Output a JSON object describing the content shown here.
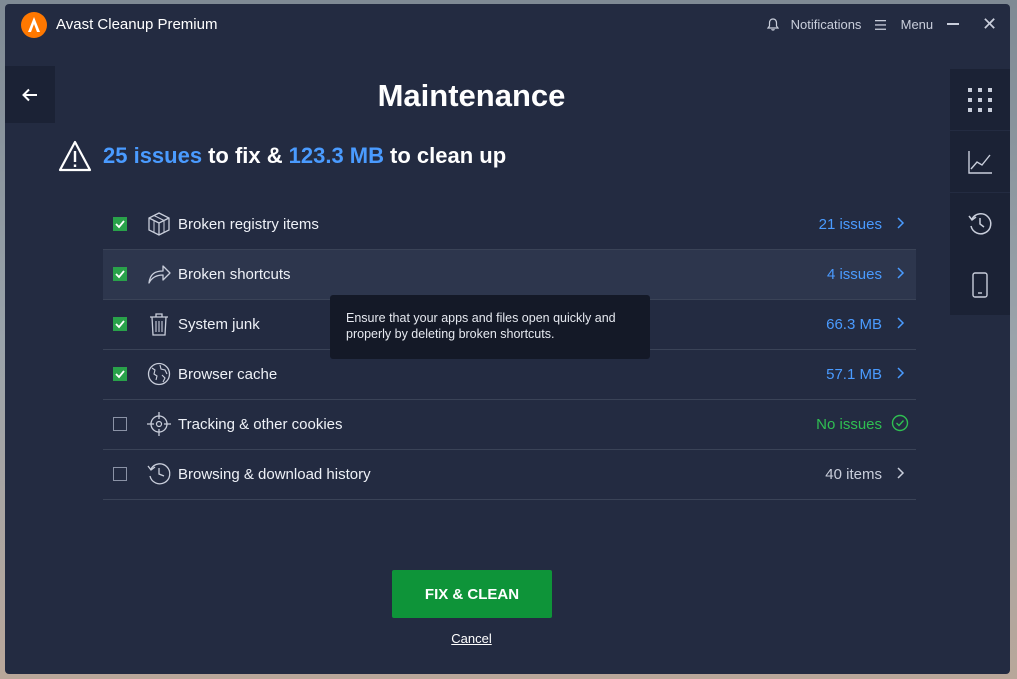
{
  "window": {
    "app_title": "Avast Cleanup Premium",
    "notifications_label": "Notifications",
    "menu_label": "Menu"
  },
  "main": {
    "title": "Maintenance",
    "summary": {
      "issues_count": "25 issues",
      "to_fix_text": "to fix &",
      "size": "123.3 MB",
      "to_clean_text": "to clean up"
    },
    "items": [
      {
        "label": "Broken registry items",
        "value": "21 issues",
        "checked": true,
        "status": "issues",
        "icon": "registry-cube-icon"
      },
      {
        "label": "Broken shortcuts",
        "value": "4 issues",
        "checked": true,
        "status": "issues",
        "icon": "shortcut-arrow-icon"
      },
      {
        "label": "System junk",
        "value": "66.3 MB",
        "checked": true,
        "status": "issues",
        "icon": "trash-icon"
      },
      {
        "label": "Browser cache",
        "value": "57.1 MB",
        "checked": true,
        "status": "issues",
        "icon": "globe-icon"
      },
      {
        "label": "Tracking & other cookies",
        "value": "No issues",
        "checked": false,
        "status": "ok",
        "icon": "crosshair-icon"
      },
      {
        "label": "Browsing & download history",
        "value": "40 items",
        "checked": false,
        "status": "info",
        "icon": "history-clock-icon"
      }
    ],
    "tooltip": "Ensure that your apps and files open quickly and properly by deleting broken shortcuts.",
    "fix_button": "FIX & CLEAN",
    "cancel_link": "Cancel"
  },
  "sidebar": {
    "buttons": [
      {
        "icon": "grid-icon"
      },
      {
        "icon": "chart-icon"
      },
      {
        "icon": "history-icon"
      },
      {
        "icon": "phone-icon"
      }
    ]
  },
  "colors": {
    "background": "#232b41",
    "accent_blue": "#4a9bff",
    "success_green": "#2fbf52",
    "button_green": "#0e9439",
    "brand_orange": "#ff7800"
  }
}
